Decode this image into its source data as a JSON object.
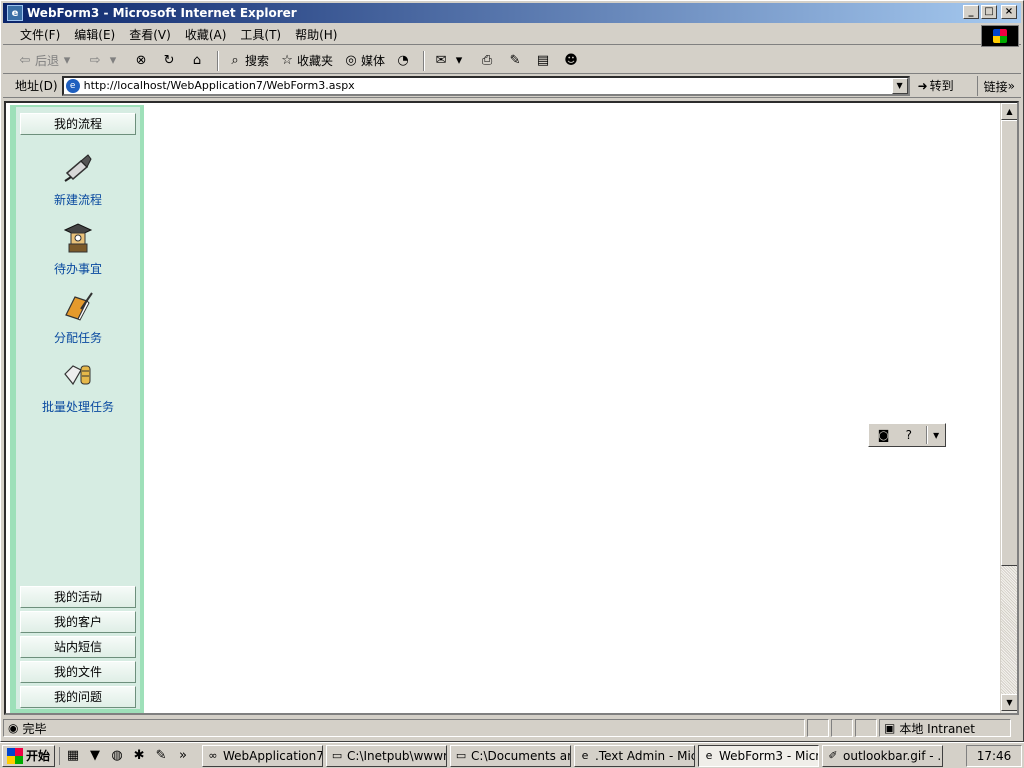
{
  "window": {
    "title": "WebForm3 - Microsoft Internet Explorer",
    "minimize": "_",
    "maximize": "□",
    "close": "×"
  },
  "menu": [
    "文件(F)",
    "编辑(E)",
    "查看(V)",
    "收藏(A)",
    "工具(T)",
    "帮助(H)"
  ],
  "toolbar": {
    "back": "后退",
    "search": "搜索",
    "favorites": "收藏夹",
    "media": "媒体"
  },
  "address": {
    "label": "地址(D)",
    "url": "http://localhost/WebApplication7/WebForm3.aspx",
    "go": "转到",
    "links": "链接"
  },
  "sidebar": {
    "top_section": "我的流程",
    "items": [
      {
        "label": "新建流程",
        "icon": "pen-brush-icon"
      },
      {
        "label": "待办事宜",
        "icon": "graduate-icon"
      },
      {
        "label": "分配任务",
        "icon": "book-pen-icon"
      },
      {
        "label": "批量处理任务",
        "icon": "hands-coins-icon"
      }
    ],
    "bottom_sections": [
      "我的活动",
      "我的客户",
      "站内短信",
      "我的文件",
      "我的问题"
    ]
  },
  "status": {
    "text": "完毕",
    "zone": "本地 Intranet"
  },
  "taskbar": {
    "start": "开始",
    "tasks": [
      {
        "label": "WebApplication7 ...",
        "active": false
      },
      {
        "label": "C:\\Inetpub\\wwwr...",
        "active": false
      },
      {
        "label": "C:\\Documents an...",
        "active": false
      },
      {
        "label": ".Text Admin - Mic...",
        "active": false
      },
      {
        "label": "WebForm3 - Micr...",
        "active": true
      },
      {
        "label": "outlookbar.gif - ...",
        "active": false
      }
    ],
    "clock": "17:46"
  }
}
